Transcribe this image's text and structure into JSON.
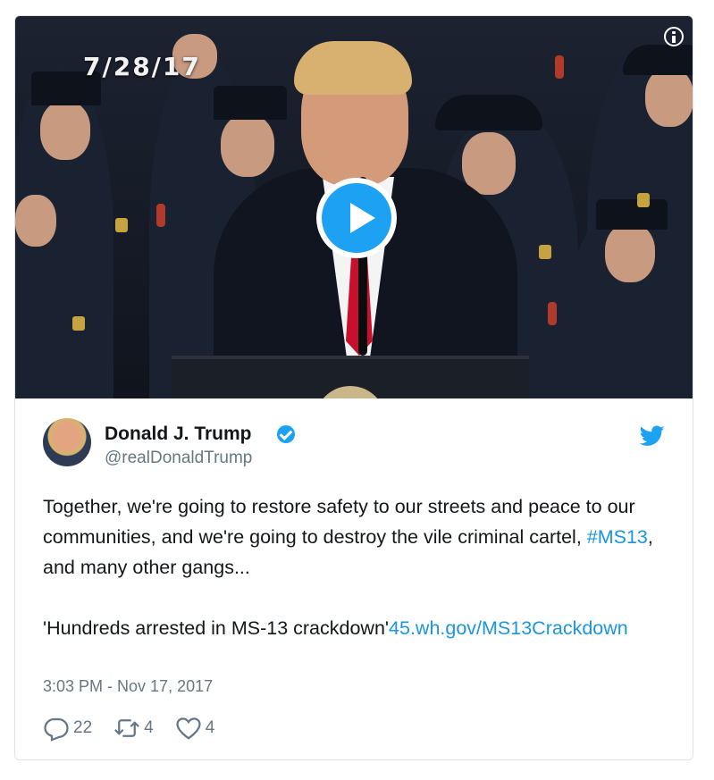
{
  "media": {
    "date_stamp": "7/28/17",
    "info_icon": "info-icon",
    "play_icon": "play-icon"
  },
  "tweet": {
    "author": {
      "name": "Donald J. Trump",
      "handle": "@realDonaldTrump",
      "verified": true
    },
    "text": {
      "line1_part1": "Together, we're going to restore safety to our streets and peace to our communities, and we're going to destroy the vile criminal cartel, ",
      "hashtag": "#MS13",
      "line1_part2": ", and many other gangs...",
      "quote": "'Hundreds arrested in MS-13 crackdown'",
      "link": "45.wh.gov/MS13Crackdown"
    },
    "timestamp": "3:03 PM - Nov 17, 2017",
    "actions": {
      "replies": "22",
      "retweets": "4",
      "likes": "4"
    }
  },
  "colors": {
    "accent": "#1da1f2",
    "link": "#1b95e0",
    "text": "#14171a",
    "muted": "#657786"
  }
}
